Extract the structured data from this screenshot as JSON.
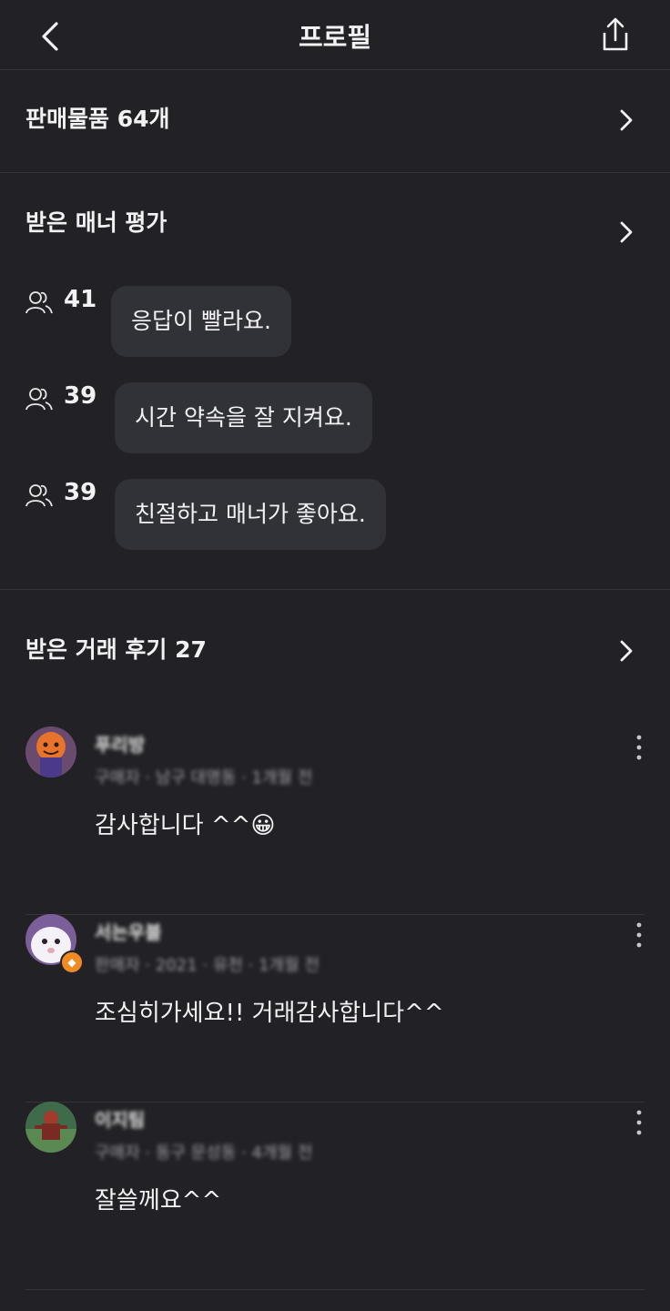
{
  "header": {
    "title": "프로필"
  },
  "sale_items": {
    "label": "판매물품 64개"
  },
  "manners": {
    "title": "받은 매너 평가",
    "items": [
      {
        "count": "41",
        "text": "응답이 빨라요."
      },
      {
        "count": "39",
        "text": "시간 약속을 잘 지켜요."
      },
      {
        "count": "39",
        "text": "친절하고 매너가 좋아요."
      }
    ]
  },
  "reviews": {
    "title": "받은 거래 후기 27",
    "items": [
      {
        "name": "푸리방",
        "meta": "구매자 · 남구 대명동 · 1개월 전",
        "text": "감사합니다 ^^😀"
      },
      {
        "name": "서는우블",
        "meta": "판매자 · 2021 · 유천 · 1개월 전",
        "text": "조심히가세요!! 거래감사합니다^^"
      },
      {
        "name": "이지팀",
        "meta": "구매자 · 동구 문성동 · 4개월 전",
        "text": "잘쓸께요^^"
      }
    ]
  },
  "colors": {
    "background": "#222226",
    "bubble": "#313238",
    "divider": "#34353a"
  },
  "icons": [
    "back-icon",
    "share-icon",
    "chevron-right-icon",
    "people-icon",
    "kebab-icon"
  ]
}
